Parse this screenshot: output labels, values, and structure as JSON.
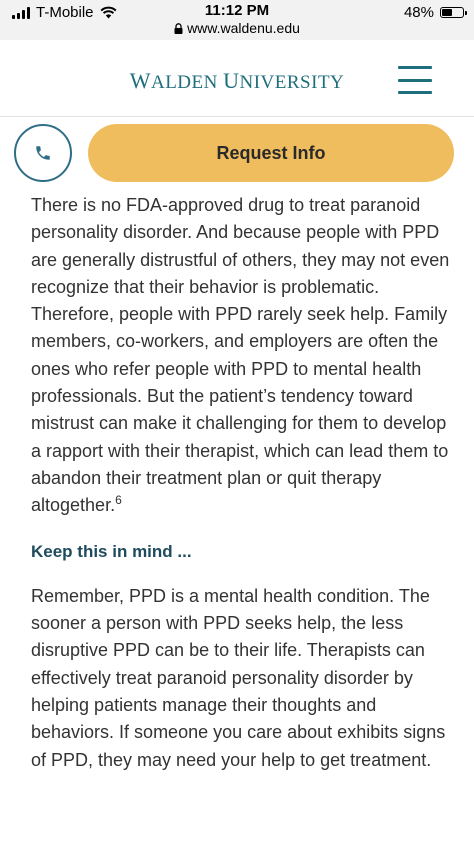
{
  "status_bar": {
    "carrier": "T-Mobile",
    "time": "11:12 PM",
    "url": "www.waldenu.edu",
    "battery_percent": "48%",
    "battery_level": 0.48
  },
  "header": {
    "logo_text": "Walden University",
    "logo_first_initial": "W",
    "logo_first_rest": "ALDEN",
    "logo_second_initial": "U",
    "logo_second_rest": "NIVERSITY",
    "menu_icon": "hamburger-menu-icon",
    "brand_color": "#1f6e7c"
  },
  "actions": {
    "phone_icon": "phone-icon",
    "request_label": "Request Info",
    "request_color": "#f0bd5e"
  },
  "article": {
    "paragraph1": "There is no FDA-approved drug to treat paranoid personality disorder. And because people with PPD are generally distrustful of others, they may not even recognize that their behavior is problematic. Therefore, people with PPD rarely seek help. Family members, co-workers, and employers are often the ones who refer people with PPD to mental health professionals. But the patient’s tendency toward mistrust can make it challenging for them to develop a rapport with their therapist, which can lead them to abandon their treatment plan or quit therapy altogether.",
    "footnote": "6",
    "subheading": "Keep this in mind ...",
    "paragraph2": "Remember, PPD is a mental health condition. The sooner a person with PPD seeks help, the less disruptive PPD can be to their life. Therapists can effectively treat paranoid personality disorder by helping patients manage their thoughts and behaviors. If someone you care about exhibits signs of PPD, they may need your help to get treatment."
  }
}
